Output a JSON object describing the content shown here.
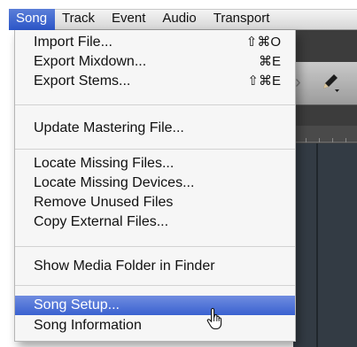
{
  "menubar": {
    "items": [
      {
        "label": "Song"
      },
      {
        "label": "Track"
      },
      {
        "label": "Event"
      },
      {
        "label": "Audio"
      },
      {
        "label": "Transport"
      }
    ]
  },
  "menu": {
    "items": [
      {
        "label": "Import File...",
        "shortcut": "⇧⌘O"
      },
      {
        "label": "Export Mixdown...",
        "shortcut": "⌘E"
      },
      {
        "label": "Export Stems...",
        "shortcut": "⇧⌘E"
      },
      {
        "label": "Update Mastering File..."
      },
      {
        "label": "Locate Missing Files..."
      },
      {
        "label": "Locate Missing Devices..."
      },
      {
        "label": "Remove Unused Files"
      },
      {
        "label": "Copy External Files..."
      },
      {
        "label": "Show Media Folder in Finder"
      },
      {
        "label": "Song Setup..."
      },
      {
        "label": "Song Information"
      }
    ],
    "highlighted_item": "Song Setup..."
  },
  "colors": {
    "menu_highlight": "#3a62d0",
    "menubar_active": "#2c56c8",
    "background_app": "#3c3c3c"
  },
  "icons": {
    "toolbar_left": "arrow-icon",
    "toolbar_right": "pencil-icon",
    "cursor": "hand-pointer-icon"
  }
}
